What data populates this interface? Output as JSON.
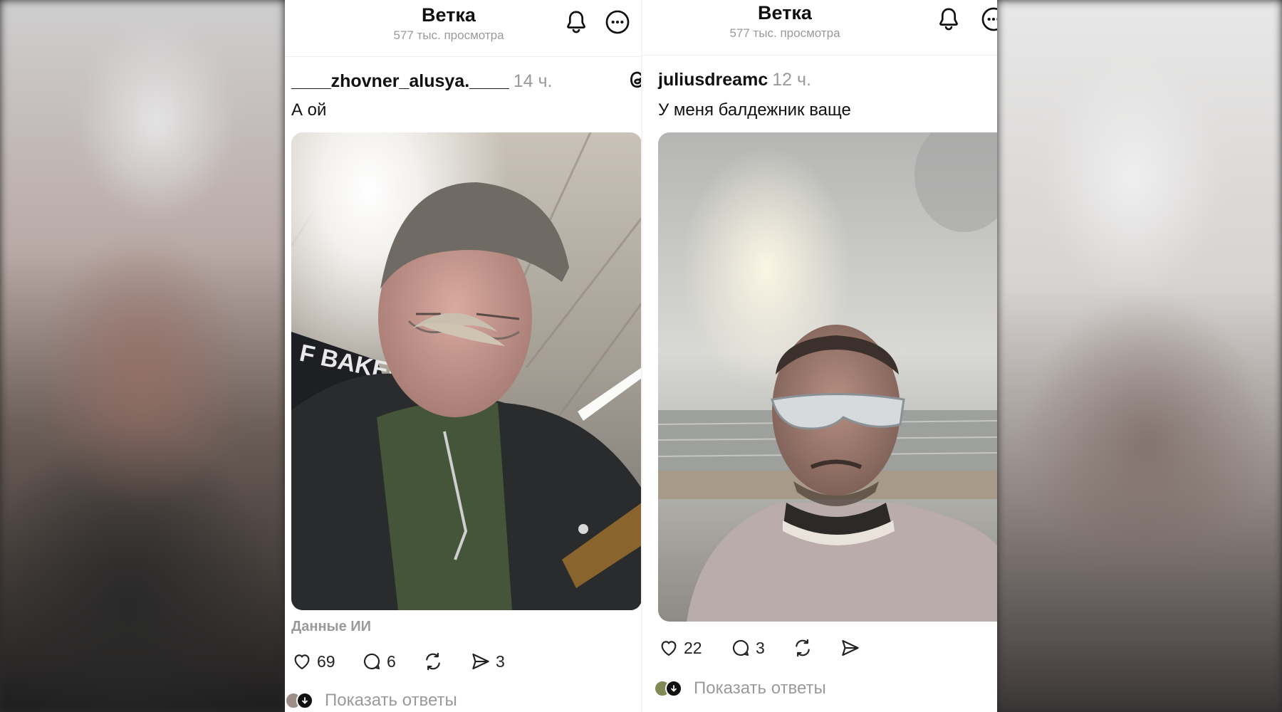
{
  "thread": {
    "title": "Ветка",
    "views": "577 тыс. просмотра"
  },
  "posts": [
    {
      "username": "____zhovner_alusya.____",
      "time": "14 ч.",
      "text": "А ой",
      "photo_text": "F BAKER",
      "ai_label": "Данные ИИ",
      "likes": "69",
      "comments": "6",
      "shares": "3",
      "show_replies": "Показать ответы"
    },
    {
      "username": "juliusdreamc",
      "time": "12 ч.",
      "text": "У меня балдежник ваще",
      "likes": "22",
      "comments": "3",
      "show_replies": "Показать ответы"
    }
  ],
  "colors": {
    "text": "#111111",
    "muted": "#9a9a9a",
    "panel": "#ffffff"
  }
}
